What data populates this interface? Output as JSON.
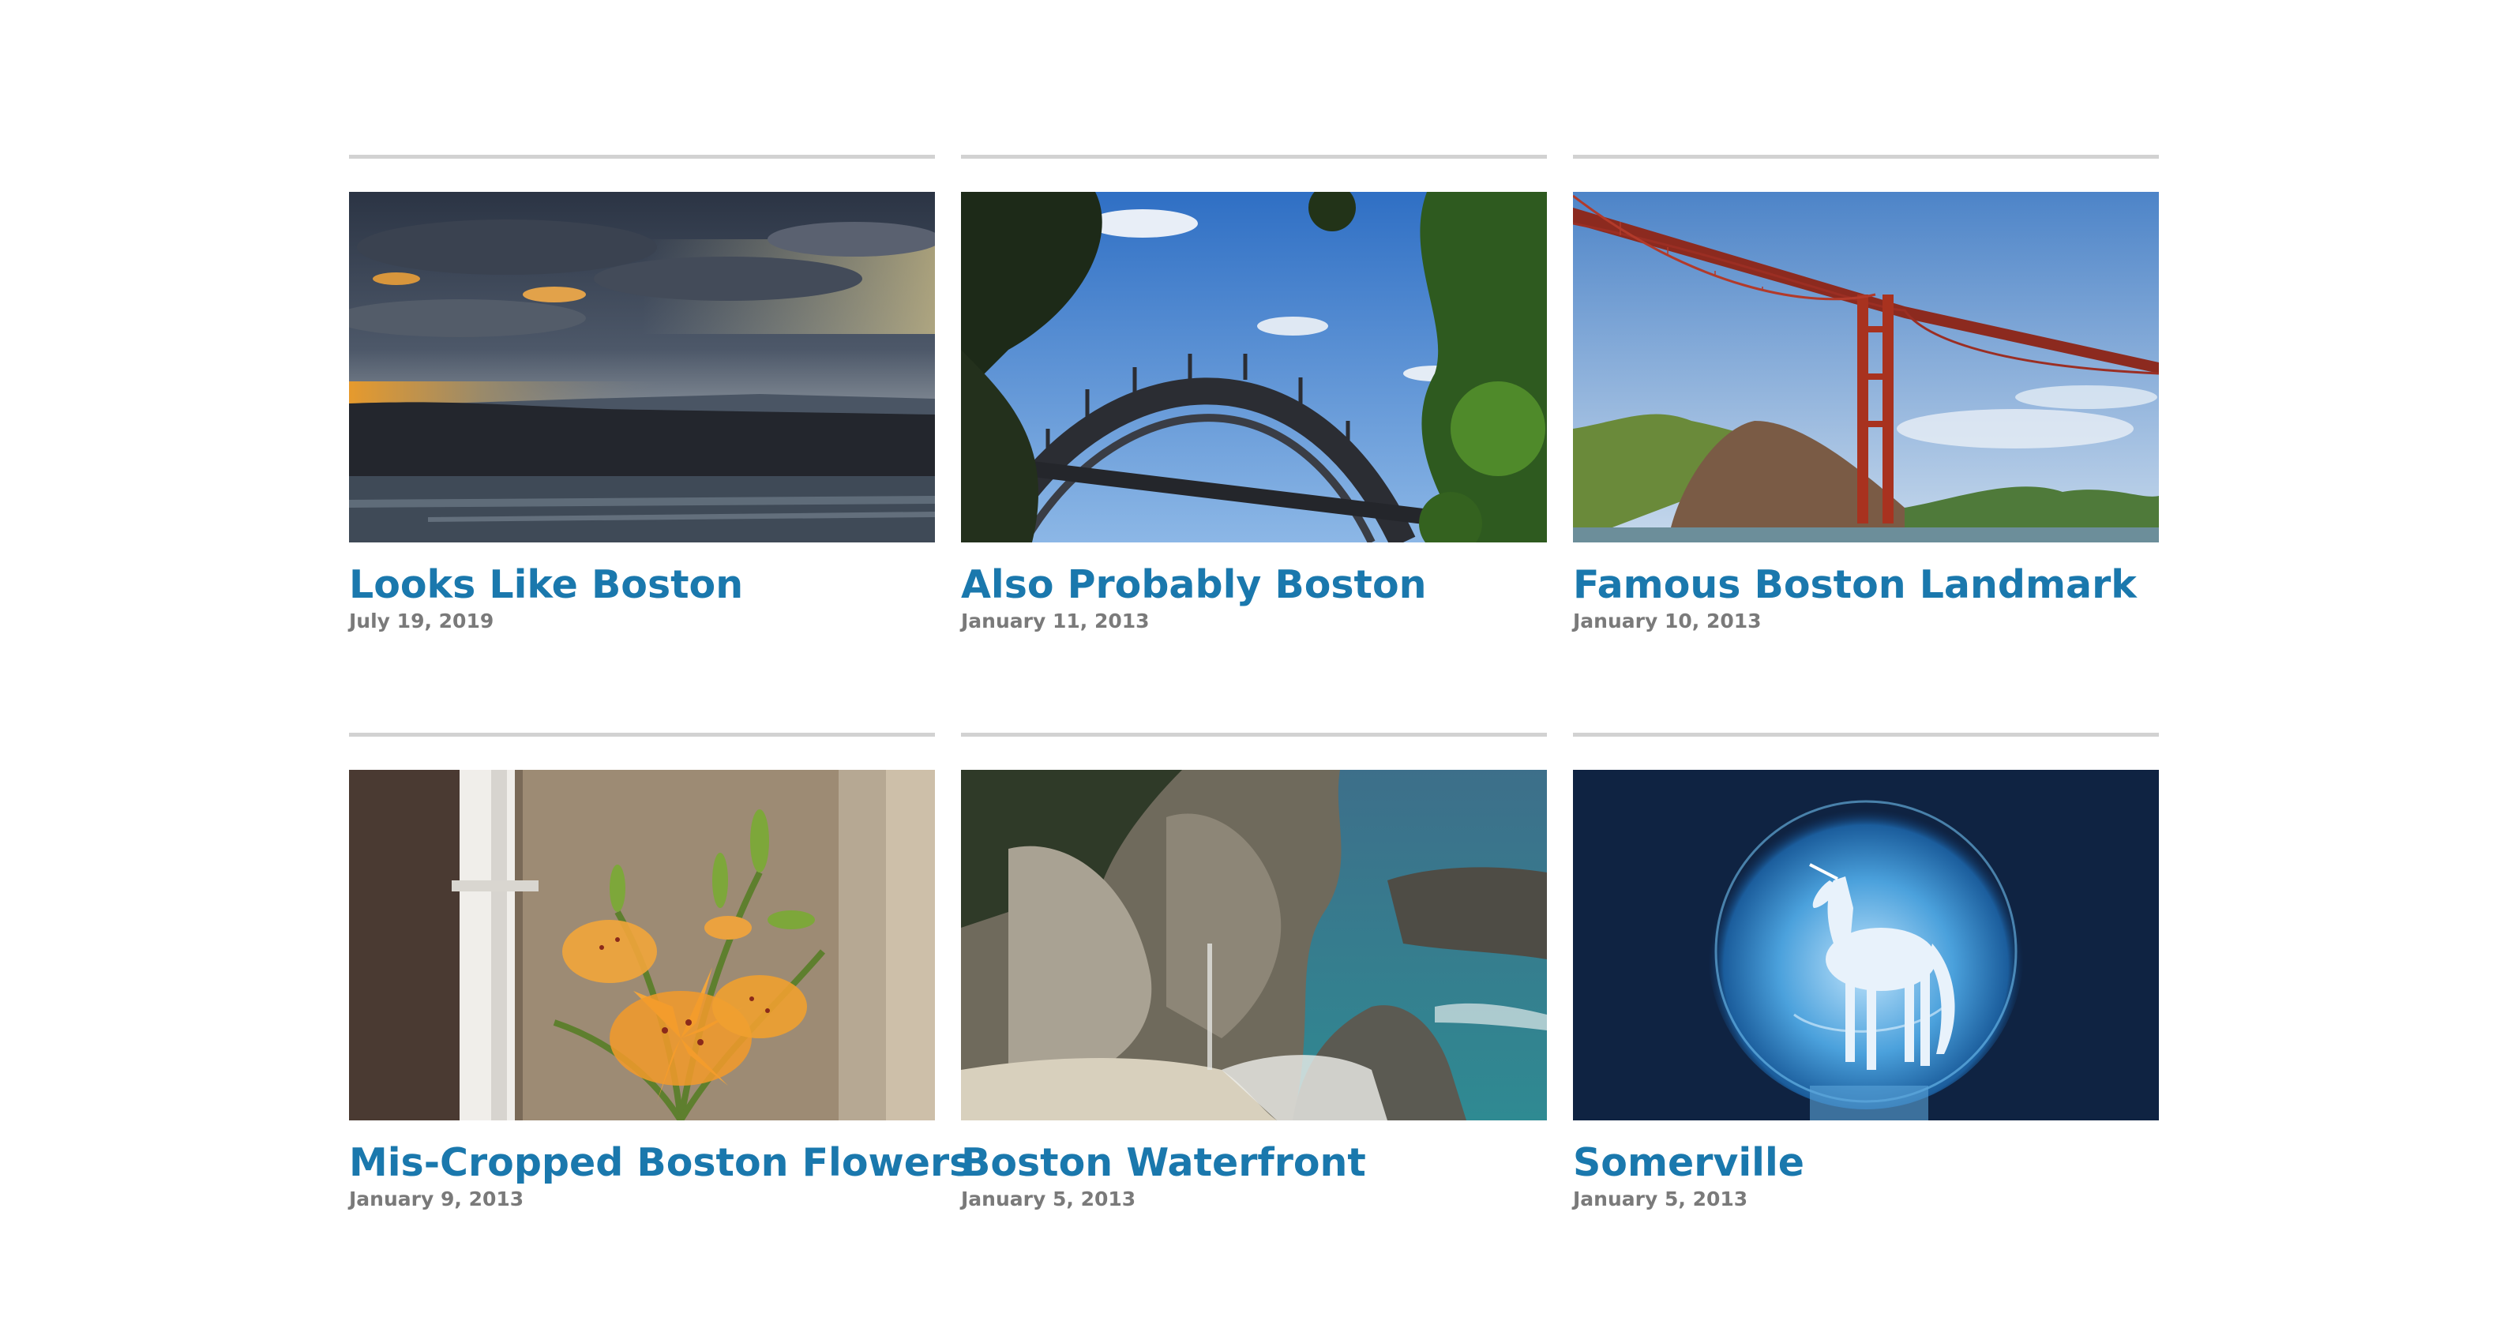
{
  "posts": [
    {
      "title": "Looks Like Boston",
      "date": "July 19, 2019",
      "image": "sunset-hills-photo"
    },
    {
      "title": "Also Probably Boston",
      "date": "January 11, 2013",
      "image": "arch-bridge-photo"
    },
    {
      "title": "Famous Boston Landmark",
      "date": "January 10, 2013",
      "image": "golden-gate-bridge-photo"
    },
    {
      "title": "Mis-Cropped Boston Flowers",
      "date": "January 9, 2013",
      "image": "orange-lilies-photo"
    },
    {
      "title": "Boston Waterfront",
      "date": "January 5, 2013",
      "image": "coastal-cliffs-photo"
    },
    {
      "title": "Somerville",
      "date": "January 5, 2013",
      "image": "unicorn-moon-photo"
    }
  ],
  "colors": {
    "title": "#1a78ad",
    "date": "#7a7a7a",
    "rule": "#d2d2d2"
  }
}
